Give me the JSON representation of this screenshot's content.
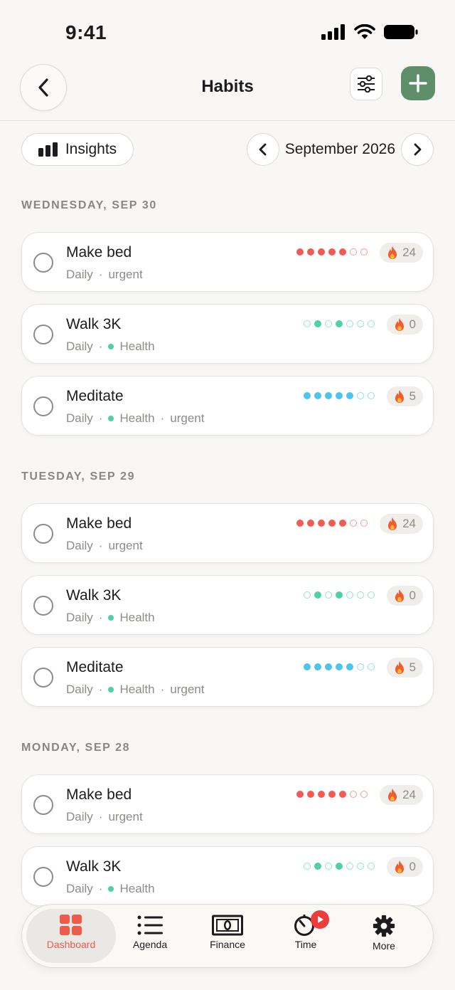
{
  "status": {
    "time": "9:41"
  },
  "header": {
    "title": "Habits"
  },
  "toolbar": {
    "insights_label": "Insights",
    "month_label": "September 2026"
  },
  "colors": {
    "red": "#f25a52",
    "teal": "#4fd1a5",
    "blue": "#4cc5ec",
    "accent_green": "#5f8e6a",
    "tab_active": "#ef5a4a"
  },
  "sections": [
    {
      "label": "WEDNESDAY, SEP 30",
      "habits": [
        {
          "name": "Make bed",
          "frequency": "Daily",
          "tag": "",
          "priority": "urgent",
          "streak": "24",
          "dot_color": "red",
          "dots": [
            1,
            1,
            1,
            1,
            1,
            0,
            0
          ]
        },
        {
          "name": "Walk 3K",
          "frequency": "Daily",
          "tag": "Health",
          "priority": "",
          "streak": "0",
          "dot_color": "teal",
          "dots": [
            0,
            1,
            0,
            1,
            0,
            0,
            0
          ]
        },
        {
          "name": "Meditate",
          "frequency": "Daily",
          "tag": "Health",
          "priority": "urgent",
          "streak": "5",
          "dot_color": "blue",
          "dots": [
            1,
            1,
            1,
            1,
            1,
            0,
            0
          ]
        }
      ]
    },
    {
      "label": "TUESDAY, SEP 29",
      "habits": [
        {
          "name": "Make bed",
          "frequency": "Daily",
          "tag": "",
          "priority": "urgent",
          "streak": "24",
          "dot_color": "red",
          "dots": [
            1,
            1,
            1,
            1,
            1,
            0,
            0
          ]
        },
        {
          "name": "Walk 3K",
          "frequency": "Daily",
          "tag": "Health",
          "priority": "",
          "streak": "0",
          "dot_color": "teal",
          "dots": [
            0,
            1,
            0,
            1,
            0,
            0,
            0
          ]
        },
        {
          "name": "Meditate",
          "frequency": "Daily",
          "tag": "Health",
          "priority": "urgent",
          "streak": "5",
          "dot_color": "blue",
          "dots": [
            1,
            1,
            1,
            1,
            1,
            0,
            0
          ]
        }
      ]
    },
    {
      "label": "MONDAY, SEP 28",
      "habits": [
        {
          "name": "Make bed",
          "frequency": "Daily",
          "tag": "",
          "priority": "urgent",
          "streak": "24",
          "dot_color": "red",
          "dots": [
            1,
            1,
            1,
            1,
            1,
            0,
            0
          ]
        },
        {
          "name": "Walk 3K",
          "frequency": "Daily",
          "tag": "Health",
          "priority": "",
          "streak": "0",
          "dot_color": "teal",
          "dots": [
            0,
            1,
            0,
            1,
            0,
            0,
            0
          ]
        }
      ]
    }
  ],
  "tabs": [
    {
      "label": "Dashboard",
      "icon": "grid-icon",
      "active": true
    },
    {
      "label": "Agenda",
      "icon": "list-icon",
      "active": false
    },
    {
      "label": "Finance",
      "icon": "banknote-icon",
      "active": false
    },
    {
      "label": "Time",
      "icon": "timer-icon",
      "active": false
    },
    {
      "label": "More",
      "icon": "gear-icon",
      "active": false
    }
  ]
}
